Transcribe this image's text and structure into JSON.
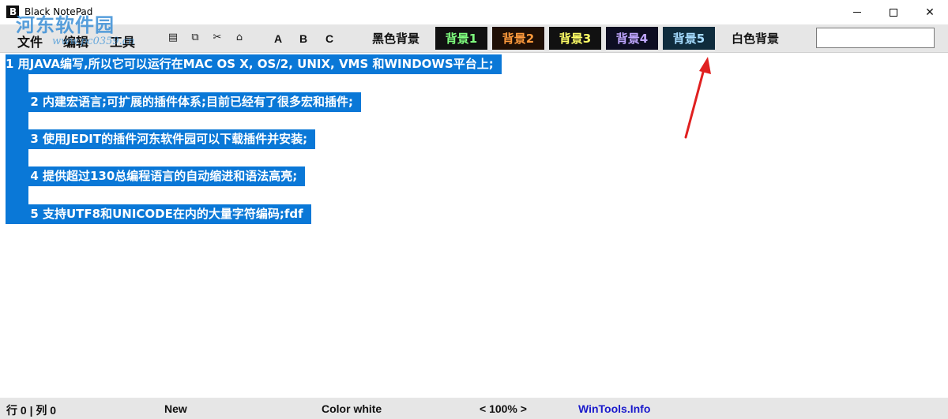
{
  "window": {
    "title": "Black NotePad",
    "watermark": "河东软件园",
    "watermark_url": "www.pc0359.cn"
  },
  "menu": {
    "file": "文件",
    "edit": "编辑",
    "tools": "工具"
  },
  "toolbar": {
    "icons": [
      "select-all-icon",
      "copy-icon",
      "cut-icon",
      "home-icon"
    ],
    "font_a": "A",
    "font_b": "B",
    "font_c": "C",
    "black_bg": "黑色背景",
    "bg_buttons": [
      {
        "label": "背景1",
        "bg": "#111111",
        "fg": "#7fff7f"
      },
      {
        "label": "背景2",
        "bg": "#1f0f05",
        "fg": "#ff9a3c"
      },
      {
        "label": "背景3",
        "bg": "#111111",
        "fg": "#ffff66"
      },
      {
        "label": "背景4",
        "bg": "#0d0d22",
        "fg": "#bfa6ff"
      },
      {
        "label": "背景5",
        "bg": "#0f2c3d",
        "fg": "#a6dcff"
      }
    ],
    "white_bg": "白色背景",
    "search_value": ""
  },
  "editor": {
    "selection_color": "#0a78d7",
    "lines": [
      "1 用JAVA编写,所以它可以运行在MAC OS X, OS/2, UNIX, VMS 和WINDOWS平台上;",
      "      2 内建宏语言;可扩展的插件体系;目前已经有了很多宏和插件;",
      "      3 使用JEDIT的插件河东软件园可以下载插件并安装;",
      "      4 提供超过130总编程语言的自动缩进和语法高亮;",
      "      5 支持UTF8和UNICODE在内的大量字符编码;fdf"
    ]
  },
  "status": {
    "position": "行 0 | 列 0",
    "state": "New",
    "color": "Color white",
    "zoom": "< 100% >",
    "link": "WinTools.Info"
  }
}
